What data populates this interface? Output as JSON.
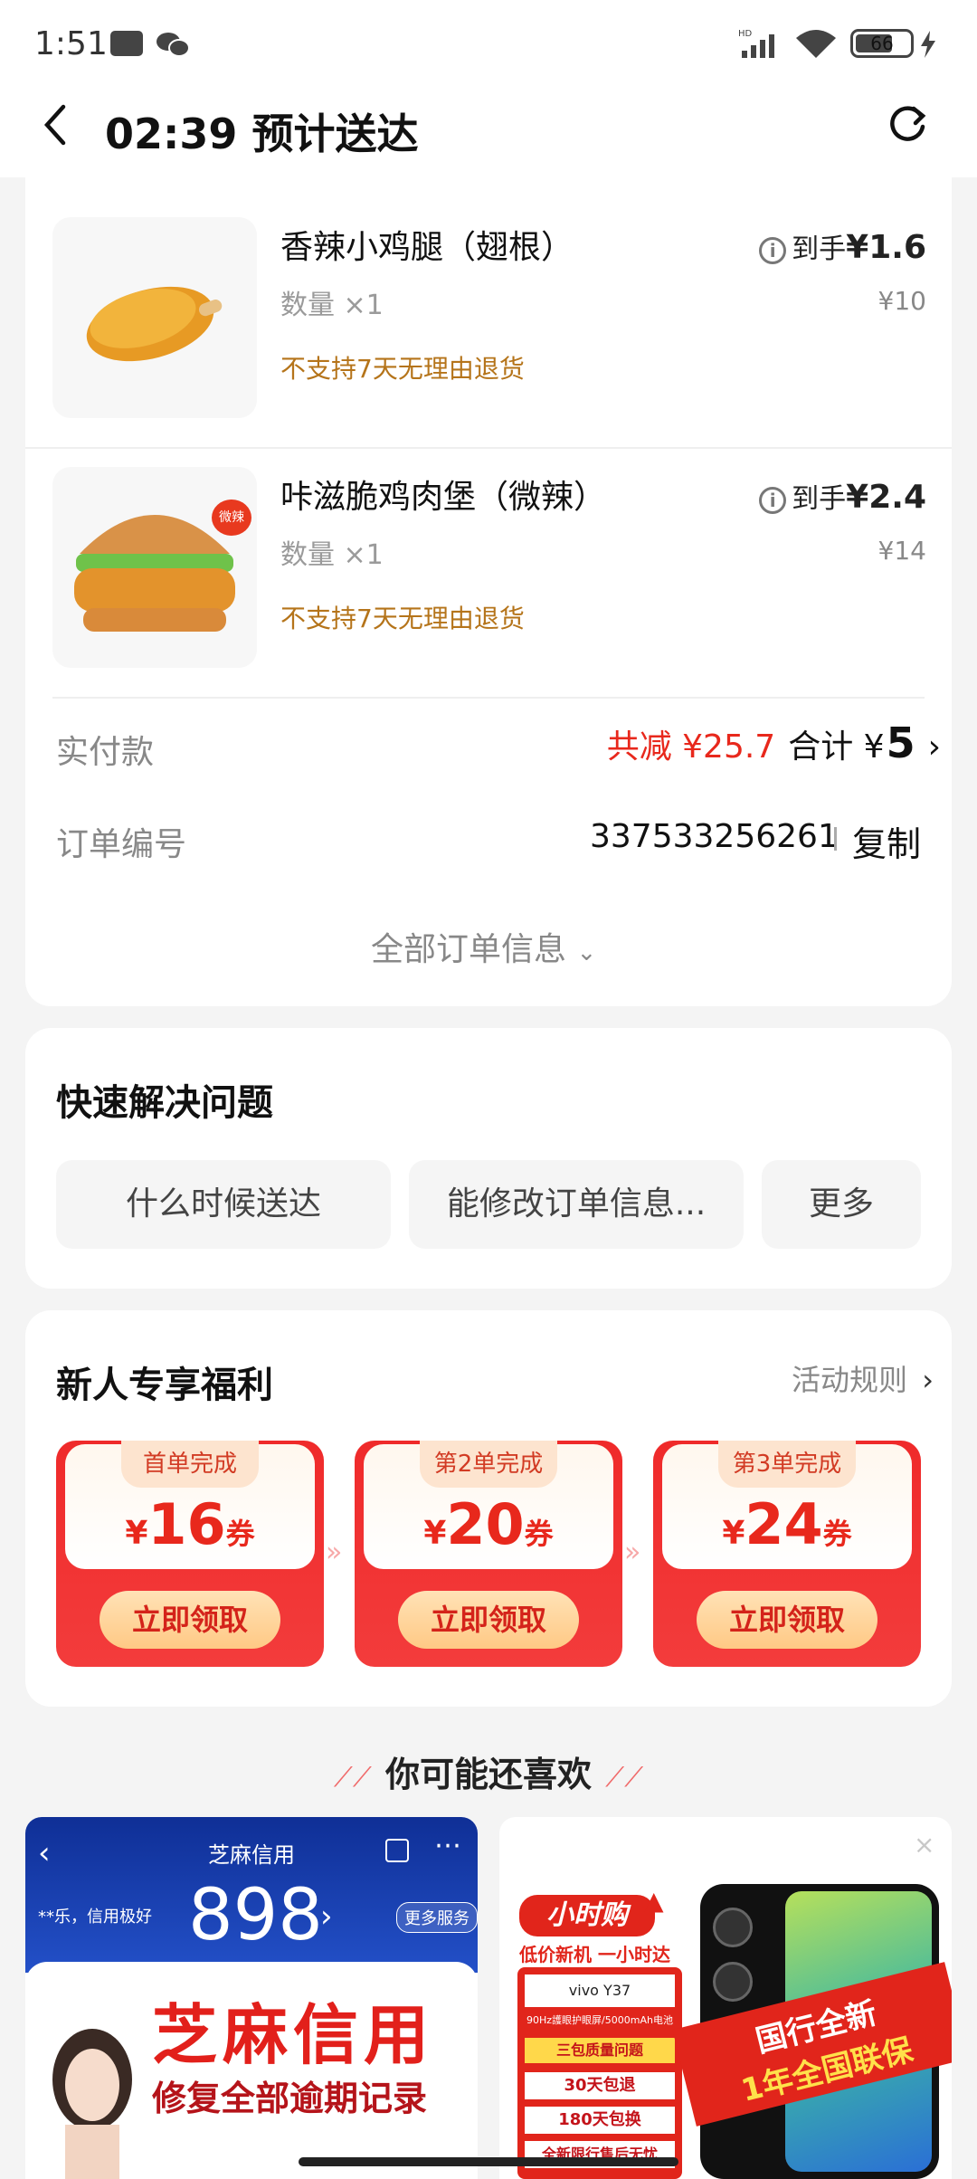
{
  "status": {
    "time": "1:51",
    "battery": "66",
    "network": "HD"
  },
  "header": {
    "title": "02:39 预计送达"
  },
  "items": [
    {
      "name": "香辣小鸡腿（翅根）",
      "qty": "数量 ×1",
      "note": "不支持7天无理由退货",
      "price_prefix": "到手",
      "price": "¥1.6",
      "orig": "¥10"
    },
    {
      "name": "咔滋脆鸡肉堡（微辣）",
      "qty": "数量 ×1",
      "note": "不支持7天无理由退货",
      "price_prefix": "到手",
      "price": "¥2.4",
      "orig": "¥14",
      "badge": "微辣"
    }
  ],
  "payment": {
    "label": "实付款",
    "discount": "共减 ¥25.7",
    "total_label": "合计 ¥",
    "total": "5"
  },
  "order": {
    "label": "订单编号",
    "number": "337533256261",
    "copy": "复制"
  },
  "all_info": "全部订单信息",
  "quick": {
    "title": "快速解决问题",
    "chips": [
      "什么时候送达",
      "能修改订单信息...",
      "更多"
    ]
  },
  "welfare": {
    "title": "新人专享福利",
    "rules": "活动规则",
    "coupons": [
      {
        "tab": "首单完成",
        "currency": "¥",
        "amount": "16",
        "unit": "券",
        "button": "立即领取"
      },
      {
        "tab": "第2单完成",
        "currency": "¥",
        "amount": "20",
        "unit": "券",
        "button": "立即领取"
      },
      {
        "tab": "第3单完成",
        "currency": "¥",
        "amount": "24",
        "unit": "券",
        "button": "立即领取"
      }
    ]
  },
  "recommend": {
    "title": "你可能还喜欢"
  },
  "ad_left": {
    "app": "芝麻信用",
    "user": "**乐，信用极好",
    "score": "898",
    "more": "更多服务",
    "headline": "芝麻信用",
    "sub": "修复全部逾期记录"
  },
  "ad_right": {
    "brand": "小时购",
    "slogan": "低价新机 一小时达",
    "model": "vivo Y37",
    "spec": "90Hz護眼护眼屏/5000mAh电池",
    "issue": "三包质量问题",
    "return": "30天包退",
    "exchange": "180天包换",
    "service": "全新限行售后无忧",
    "banner1": "国行全新",
    "banner2": "1年全国联保"
  },
  "colors": {
    "accent": "#e8281c",
    "brand_note": "#b5741a",
    "page_bg": "#f4f4f4"
  }
}
